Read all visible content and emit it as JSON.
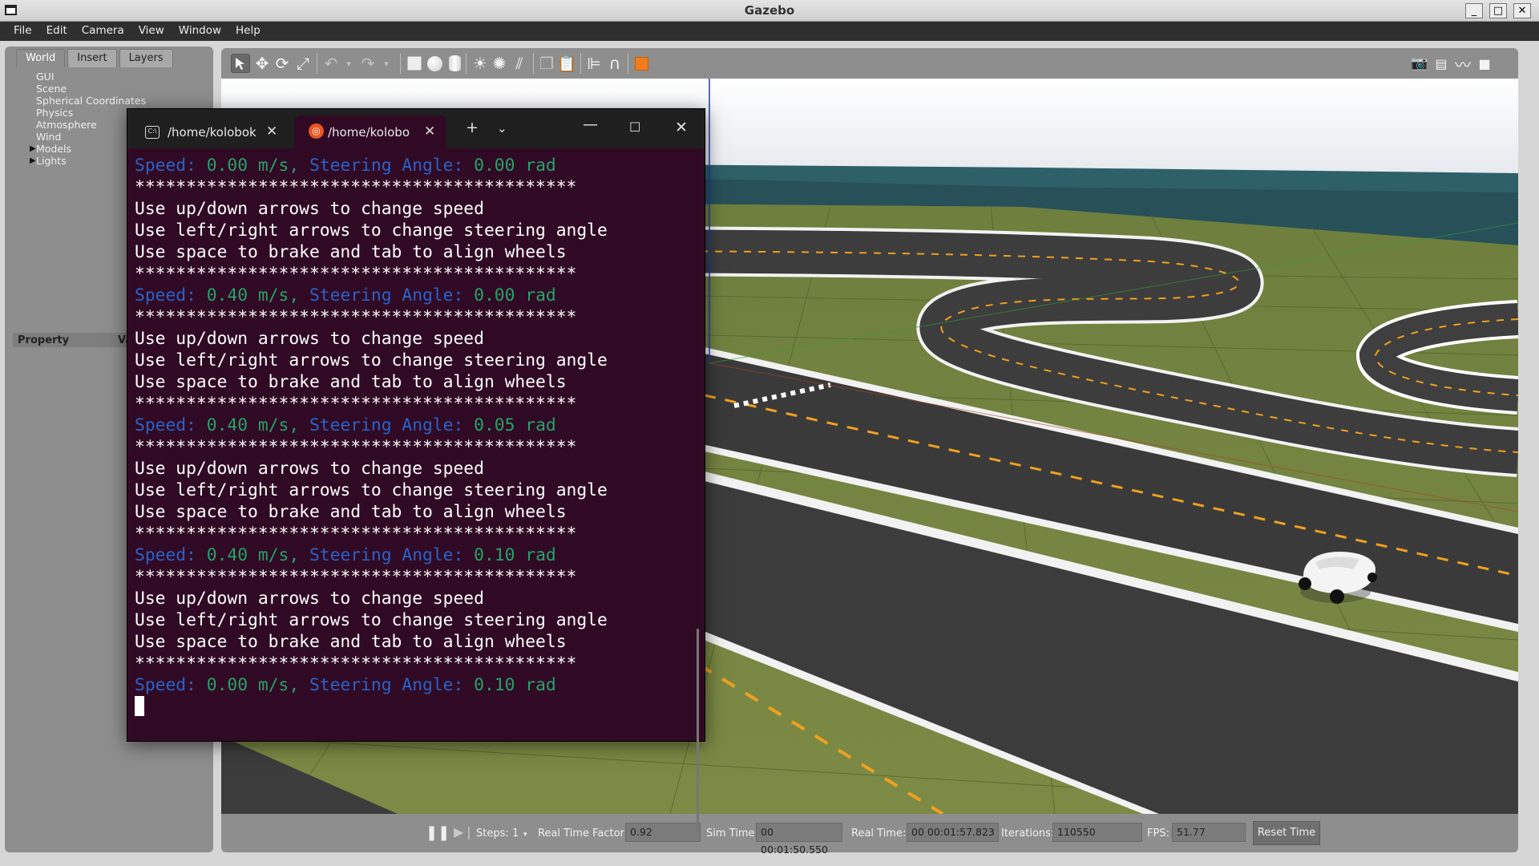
{
  "window": {
    "title": "Gazebo"
  },
  "menu": [
    "File",
    "Edit",
    "Camera",
    "View",
    "Window",
    "Help"
  ],
  "left_panel": {
    "tabs": [
      "World",
      "Insert",
      "Layers"
    ],
    "active_tab": "World",
    "tree": [
      {
        "label": "GUI",
        "expandable": false
      },
      {
        "label": "Scene",
        "expandable": false
      },
      {
        "label": "Spherical Coordinates",
        "expandable": false
      },
      {
        "label": "Physics",
        "expandable": false
      },
      {
        "label": "Atmosphere",
        "expandable": false
      },
      {
        "label": "Wind",
        "expandable": false
      },
      {
        "label": "Models",
        "expandable": true
      },
      {
        "label": "Lights",
        "expandable": true
      }
    ],
    "property_header": {
      "property": "Property",
      "value": "Va"
    }
  },
  "toolbar": {
    "icons": [
      "select-arrow-icon",
      "translate-icon",
      "rotate-icon",
      "scale-icon",
      "undo-icon",
      "redo-icon",
      "box-icon",
      "sphere-icon",
      "cylinder-icon",
      "point-light-icon",
      "spot-light-icon",
      "directional-light-icon",
      "copy-icon",
      "paste-icon",
      "align-icon",
      "snap-icon",
      "view-angle-icon",
      "screenshot-icon",
      "log-icon",
      "plot-icon",
      "video-icon"
    ]
  },
  "bottom_bar": {
    "steps_label": "Steps:",
    "steps_value": "1",
    "rtf_label": "Real Time Factor:",
    "rtf_value": "0.92",
    "sim_time_label": "Sim Time:",
    "sim_time_value": "00 00:01:50.550",
    "real_time_label": "Real Time:",
    "real_time_value": "00 00:01:57.823",
    "iterations_label": "Iterations:",
    "iterations_value": "110550",
    "fps_label": "FPS:",
    "fps_value": "51.77",
    "reset_label": "Reset Time"
  },
  "terminal": {
    "tabs": [
      {
        "title": "/home/kolobok",
        "active": false
      },
      {
        "title": "/home/kolobo",
        "active": true
      }
    ],
    "lines": [
      {
        "type": "status",
        "speed": "0.00",
        "angle": "0.00"
      },
      {
        "type": "text",
        "text": "*******************************************"
      },
      {
        "type": "text",
        "text": "Use up/down arrows to change speed"
      },
      {
        "type": "text",
        "text": "Use left/right arrows to change steering angle"
      },
      {
        "type": "text",
        "text": "Use space to brake and tab to align wheels"
      },
      {
        "type": "text",
        "text": "*******************************************"
      },
      {
        "type": "status",
        "speed": "0.40",
        "angle": "0.00"
      },
      {
        "type": "text",
        "text": "*******************************************"
      },
      {
        "type": "text",
        "text": "Use up/down arrows to change speed"
      },
      {
        "type": "text",
        "text": "Use left/right arrows to change steering angle"
      },
      {
        "type": "text",
        "text": "Use space to brake and tab to align wheels"
      },
      {
        "type": "text",
        "text": "*******************************************"
      },
      {
        "type": "status",
        "speed": "0.40",
        "angle": "0.05"
      },
      {
        "type": "text",
        "text": "*******************************************"
      },
      {
        "type": "text",
        "text": "Use up/down arrows to change speed"
      },
      {
        "type": "text",
        "text": "Use left/right arrows to change steering angle"
      },
      {
        "type": "text",
        "text": "Use space to brake and tab to align wheels"
      },
      {
        "type": "text",
        "text": "*******************************************"
      },
      {
        "type": "status",
        "speed": "0.40",
        "angle": "0.10"
      },
      {
        "type": "text",
        "text": "*******************************************"
      },
      {
        "type": "text",
        "text": "Use up/down arrows to change speed"
      },
      {
        "type": "text",
        "text": "Use left/right arrows to change steering angle"
      },
      {
        "type": "text",
        "text": "Use space to brake and tab to align wheels"
      },
      {
        "type": "text",
        "text": "*******************************************"
      },
      {
        "type": "status",
        "speed": "0.00",
        "angle": "0.10"
      }
    ],
    "status_labels": {
      "speed": "Speed:",
      "speed_unit": "m/s,",
      "angle": "Steering Angle:",
      "angle_unit": "rad"
    }
  },
  "colors": {
    "terminal_bg": "#300a24",
    "terminal_label": "#2a62c9",
    "terminal_value": "#26a269",
    "ubuntu_orange": "#e95420"
  }
}
